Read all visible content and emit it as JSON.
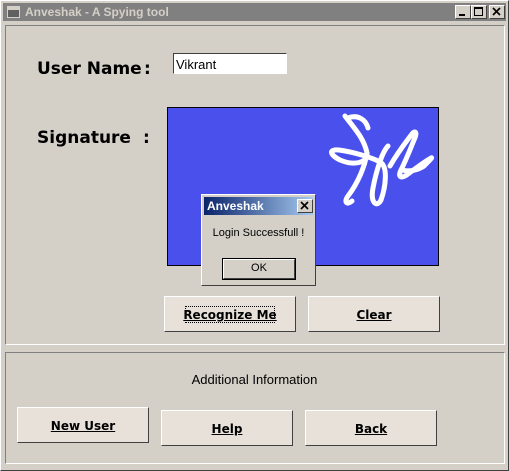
{
  "window": {
    "title": "Anveshak - A Spying tool"
  },
  "form": {
    "username_label": "User Name",
    "username_colon": ":",
    "username_value": "Vikrant",
    "signature_label": "Signature",
    "signature_colon": ":",
    "signature_pad_color": "#4a50ec"
  },
  "buttons": {
    "recognize": "Recognize Me",
    "clear": "Clear",
    "new_user": "New User",
    "help": "Help",
    "back": "Back"
  },
  "additional_info": "Additional Information",
  "dialog": {
    "title": "Anveshak",
    "message": "Login Successfull !",
    "ok": "OK"
  },
  "colors": {
    "window_bg": "#d4d0c8",
    "button_bg": "#e7e1da",
    "inactive_title": "#808080",
    "active_title": "#0a246a"
  },
  "icons": [
    "app-icon",
    "minimize-icon",
    "maximize-icon",
    "close-icon"
  ]
}
